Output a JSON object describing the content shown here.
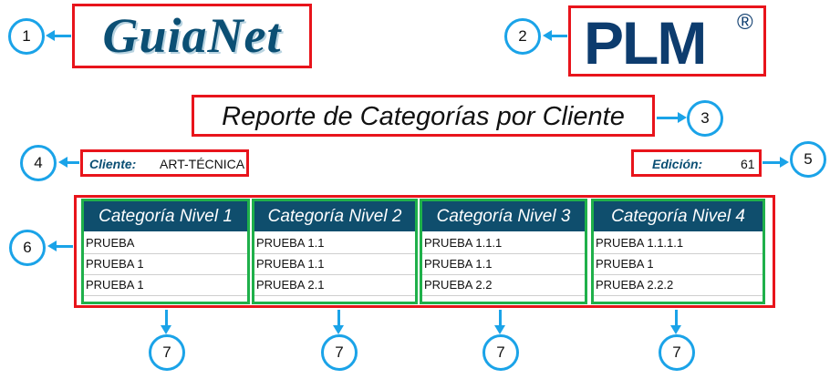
{
  "logos": {
    "guianet": "GuiaNet",
    "plm": "PLM",
    "plm_registered": "®"
  },
  "report": {
    "title": "Reporte de Categorías por Cliente",
    "client_label": "Cliente:",
    "client_value": "ART-TÉCNICA",
    "edition_label": "Edición:",
    "edition_value": "61"
  },
  "table": {
    "columns": [
      {
        "header": "Categoría Nivel 1",
        "rows": [
          "PRUEBA",
          "PRUEBA 1",
          "PRUEBA 1"
        ]
      },
      {
        "header": "Categoría Nivel 2",
        "rows": [
          "PRUEBA 1.1",
          "PRUEBA 1.1",
          "PRUEBA 2.1"
        ]
      },
      {
        "header": "Categoría Nivel 3",
        "rows": [
          "PRUEBA 1.1.1",
          "PRUEBA 1.1",
          "PRUEBA 2.2"
        ]
      },
      {
        "header": "Categoría Nivel 4",
        "rows": [
          "PRUEBA 1.1.1.1",
          "PRUEBA 1",
          "PRUEBA 2.2.2"
        ]
      }
    ]
  },
  "callouts": [
    "1",
    "2",
    "3",
    "4",
    "5",
    "6",
    "7",
    "7",
    "7",
    "7"
  ],
  "colors": {
    "callout": "#1aa3e8",
    "highlight": "#e8141b",
    "column_highlight": "#1fb04a",
    "header_bg": "#0f4e6d"
  }
}
